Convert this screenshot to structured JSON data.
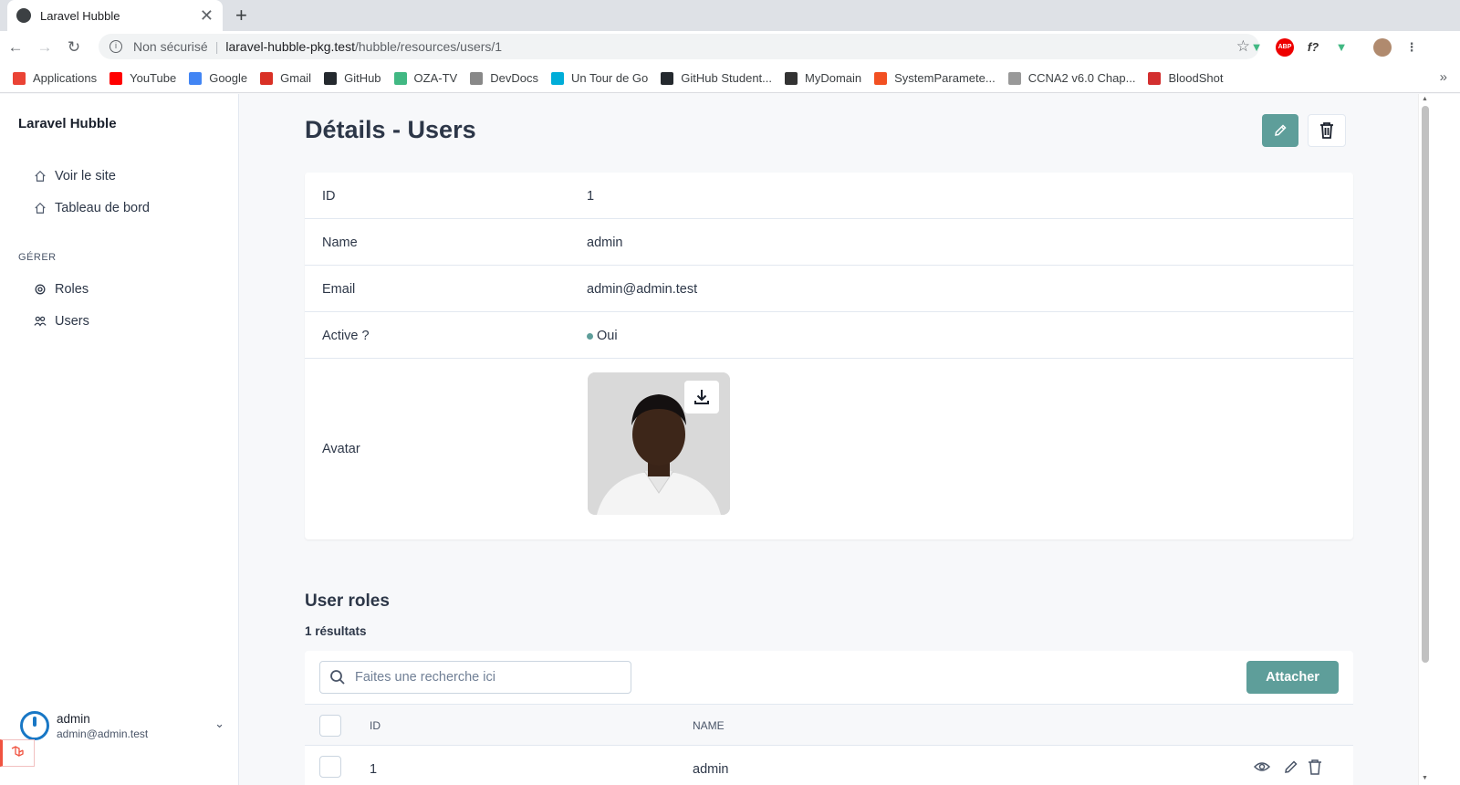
{
  "browser": {
    "tab_title": "Laravel Hubble",
    "new_tab": "+",
    "close": "✕",
    "insecure_label": "Non sécurisé",
    "url_host": "laravel-hubble-pkg.test",
    "url_path": "/hubble/resources/users/1",
    "bookmarks": [
      {
        "label": "Applications",
        "color": "#ea4335"
      },
      {
        "label": "YouTube",
        "color": "#ff0000"
      },
      {
        "label": "Google",
        "color": "#4285f4"
      },
      {
        "label": "Gmail",
        "color": "#d93025"
      },
      {
        "label": "GitHub",
        "color": "#24292e"
      },
      {
        "label": "OZA-TV",
        "color": "#41b883"
      },
      {
        "label": "DevDocs",
        "color": "#888888"
      },
      {
        "label": "Un Tour de Go",
        "color": "#00add8"
      },
      {
        "label": "GitHub Student...",
        "color": "#24292e"
      },
      {
        "label": "MyDomain",
        "color": "#333333"
      },
      {
        "label": "SystemParamete...",
        "color": "#f25022"
      },
      {
        "label": "CCNA2 v6.0 Chap...",
        "color": "#999999"
      },
      {
        "label": "BloodShot",
        "color": "#d32f2f"
      }
    ],
    "more": "»"
  },
  "sidebar": {
    "brand": "Laravel Hubble",
    "items": [
      {
        "label": "Voir le site",
        "icon": "home-icon"
      },
      {
        "label": "Tableau de bord",
        "icon": "home-icon"
      }
    ],
    "section": "GÉRER",
    "manage": [
      {
        "label": "Roles",
        "icon": "fingerprint-icon"
      },
      {
        "label": "Users",
        "icon": "users-icon"
      }
    ],
    "user": {
      "name": "admin",
      "email": "admin@admin.test"
    }
  },
  "details": {
    "title": "Détails - Users",
    "rows": [
      {
        "label": "ID",
        "value": "1"
      },
      {
        "label": "Name",
        "value": "admin"
      },
      {
        "label": "Email",
        "value": "admin@admin.test"
      },
      {
        "label": "Active ?",
        "value": "Oui"
      },
      {
        "label": "Avatar",
        "value": ""
      }
    ]
  },
  "roles": {
    "title": "User roles",
    "count": "1 résultats",
    "search_placeholder": "Faites une recherche ici",
    "attach_label": "Attacher",
    "columns": [
      "ID",
      "NAME"
    ],
    "rows": [
      {
        "id": "1",
        "name": "admin"
      }
    ]
  },
  "colors": {
    "accent": "#5e9e9a",
    "avatar_ring": "#1877c5"
  }
}
